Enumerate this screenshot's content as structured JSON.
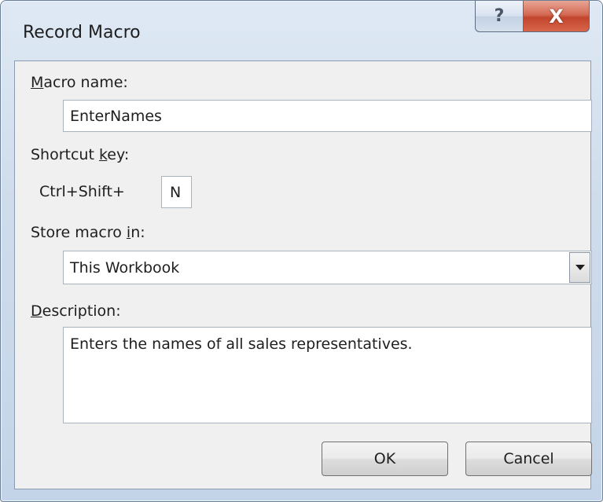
{
  "window": {
    "title": "Record Macro",
    "help_glyph": "?",
    "close_glyph": "X"
  },
  "macro_name": {
    "label_first": "M",
    "label_rest": "acro name:",
    "value": "EnterNames"
  },
  "shortcut": {
    "label_pre": "Shortcut ",
    "label_ul": "k",
    "label_post": "ey:",
    "prefix": "Ctrl+Shift+",
    "value": "N"
  },
  "store": {
    "label_pre": "Store macro ",
    "label_ul": "i",
    "label_post": "n:",
    "selected": "This Workbook"
  },
  "description": {
    "label_first": "D",
    "label_rest": "escription:",
    "value": "Enters the names of all sales representatives."
  },
  "buttons": {
    "ok": "OK",
    "cancel": "Cancel"
  },
  "icons": {
    "help": "help-icon",
    "close": "close-icon",
    "dropdown": "chevron-down-icon"
  }
}
